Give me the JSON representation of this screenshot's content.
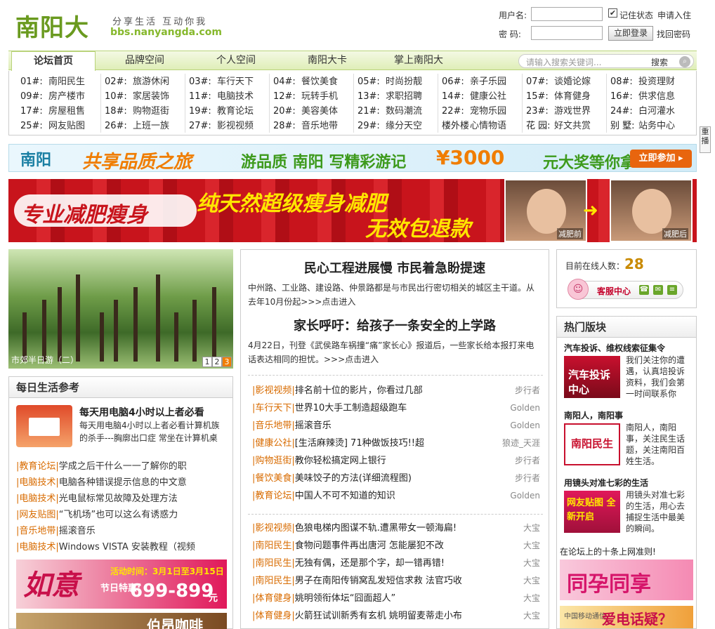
{
  "header": {
    "logo": "南阳大",
    "slogan": "分享生活 互动你我",
    "domain": "bbs.nanyangda.com"
  },
  "login": {
    "username_label": "用户名:",
    "password_label": "密  码:",
    "remember": "记住状态",
    "checked_mark": "✔",
    "apply": "申请入住",
    "login_button": "立即登录",
    "find_password": "找回密码"
  },
  "nav": {
    "tabs": [
      "论坛首页",
      "品牌空间",
      "个人空间",
      "南阳大卡",
      "掌上南阳大"
    ],
    "search_placeholder": "请输入搜索关键词...",
    "search_button": "搜索"
  },
  "boards": [
    {
      "num": "01#:",
      "name": "南阳民生"
    },
    {
      "num": "02#:",
      "name": "旅游休闲"
    },
    {
      "num": "03#:",
      "name": "车行天下"
    },
    {
      "num": "04#:",
      "name": "餐饮美食"
    },
    {
      "num": "05#:",
      "name": "时尚扮靓"
    },
    {
      "num": "06#:",
      "name": "亲子乐园"
    },
    {
      "num": "07#:",
      "name": "谈婚论嫁"
    },
    {
      "num": "08#:",
      "name": "投资理财"
    },
    {
      "num": "09#:",
      "name": "房产楼市"
    },
    {
      "num": "10#:",
      "name": "家居装饰"
    },
    {
      "num": "11#:",
      "name": "电脑技术"
    },
    {
      "num": "12#:",
      "name": "玩转手机"
    },
    {
      "num": "13#:",
      "name": "求职招聘"
    },
    {
      "num": "14#:",
      "name": "健康公社"
    },
    {
      "num": "15#:",
      "name": "体育健身"
    },
    {
      "num": "16#:",
      "name": "供求信息"
    },
    {
      "num": "17#:",
      "name": "房屋租售"
    },
    {
      "num": "18#:",
      "name": "购物逛街"
    },
    {
      "num": "19#:",
      "name": "教育论坛"
    },
    {
      "num": "20#:",
      "name": "美容美体"
    },
    {
      "num": "21#:",
      "name": "数码潮流"
    },
    {
      "num": "22#:",
      "name": "宠物乐园"
    },
    {
      "num": "23#:",
      "name": "游戏世界"
    },
    {
      "num": "24#:",
      "name": "白河灌水"
    },
    {
      "num": "25#:",
      "name": "网友贴图"
    },
    {
      "num": "26#:",
      "name": "上班一族"
    },
    {
      "num": "27#:",
      "name": "影视视频"
    },
    {
      "num": "28#:",
      "name": "音乐地带"
    },
    {
      "num": "29#:",
      "name": "缘分天空"
    },
    {
      "num": "楼外楼",
      "name": "心情物语"
    },
    {
      "num": "花 园:",
      "name": "好文共赏"
    },
    {
      "num": "别 墅:",
      "name": "站务中心"
    }
  ],
  "sidetag": "重播",
  "banner1": {
    "logo": "南阳",
    "t1": "共享品质之旅",
    "t2": "游品质 南阳 写精彩游记",
    "t3": "¥3000",
    "t4": "元大奖等你拿",
    "join": "立即参加 ▸"
  },
  "banner2": {
    "s1": "专业减肥瘦身",
    "s2": "纯天然超级瘦身减肥",
    "s3": "无效包退款",
    "arrow": "➜",
    "before": "减肥前",
    "after": "减肥后"
  },
  "photo": {
    "caption": "市郊半日游（二）",
    "pages": [
      "1",
      "2",
      "3"
    ]
  },
  "daily": {
    "title": "每日生活参考",
    "feature_title": "每天用电脑4小时以上者必看",
    "feature_desc": "每天用电脑4小时以上者必看计算机族的杀手---胸廓出口症 常坐在计算机桌",
    "items": [
      {
        "cat": "|教育论坛|",
        "text": "学成之后干什么一一了解你的职"
      },
      {
        "cat": "|电脑技术|",
        "text": "电脑各种错误提示信息的中文意"
      },
      {
        "cat": "|电脑技术|",
        "text": "光电鼠标常见故障及处理方法"
      },
      {
        "cat": "|网友贴图|",
        "text": "“飞机场”也可以这么有诱惑力"
      },
      {
        "cat": "|音乐地带|",
        "text": "摇滚音乐"
      },
      {
        "cat": "|电脑技术|",
        "text": "Windows VISTA 安装教程（视频"
      }
    ],
    "ad1": {
      "a": "如意",
      "b": "活动时间：3月1日至3月15日",
      "c": "节日特惠:",
      "d": "699-899",
      "e": "元"
    },
    "ad2": "伯昂咖啡"
  },
  "middle": {
    "news": [
      {
        "title": "民心工程进展慢 市民着急盼提速",
        "body": "中州路、工业路、建设路、仲景路都是与市民出行密切相关的城区主干道。从去年10月份起>>>点击进入"
      },
      {
        "title": "家长呼吁：给孩子一条安全的上学路",
        "body": "4月22日，刊登《武侯路车祸撞“痛”家长心》报道后，一些家长给本报打来电话表达相同的担忧。>>>点击进入"
      }
    ],
    "list1": [
      {
        "cat": "|影视视频|",
        "text": "排名前十位的影片，你看过几部",
        "author": "步行者"
      },
      {
        "cat": "|车行天下|",
        "text": "世界10大手工制造超级跑车",
        "author": "Golden"
      },
      {
        "cat": "|音乐地带|",
        "text": "摇滚音乐",
        "author": "Golden"
      },
      {
        "cat": "|健康公社|",
        "text": "[生活麻辣烫] 71种做饭技巧!!超",
        "author": "狼迹_天涯"
      },
      {
        "cat": "|购物逛街|",
        "text": "教你轻松搞定网上银行",
        "author": "步行者"
      },
      {
        "cat": "|餐饮美食|",
        "text": "美味饺子的方法(详细流程图)",
        "author": "步行者"
      },
      {
        "cat": "|教育论坛|",
        "text": "中国人不可不知道的知识",
        "author": "Golden"
      }
    ],
    "list2": [
      {
        "cat": "|影视视频|",
        "text": "色狼电梯内图谋不轨.遭黑带女一顿海扁!",
        "author": "大宝"
      },
      {
        "cat": "|南阳民生|",
        "text": "食物问题事件再出唐河 怎能屡犯不改",
        "author": "大宝"
      },
      {
        "cat": "|南阳民生|",
        "text": "无独有偶，还是那个字，却一错再错!",
        "author": "大宝"
      },
      {
        "cat": "|南阳民生|",
        "text": "男子在南阳传销窝乱发短信求救 法官巧收",
        "author": "大宝"
      },
      {
        "cat": "|体育健身|",
        "text": "姚明领衔体坛“囧面超人”",
        "author": "大宝"
      },
      {
        "cat": "|体育健身|",
        "text": "火箭狂试训新秀有玄机 姚明留麦蒂走小布",
        "author": "大宝"
      }
    ]
  },
  "online": {
    "label": "目前在线人数：",
    "count": "28",
    "service": "客服中心",
    "face": "☺",
    "icon_phone": "☎",
    "icon_mail": "✉",
    "icon_doc": "≡"
  },
  "hot": {
    "title": "热门版块",
    "sections": [
      {
        "title": "汽车投诉、维权线索征集令",
        "img_text": "汽车投诉中心",
        "desc": "我们关注你的遭遇，认真培投诉资料，我们会第一时间联系你"
      },
      {
        "title": "南阳人，南阳事",
        "img_text": "南阳民生",
        "desc": "南阳人，南阳事，关注民生话题，关注南阳百姓生活。"
      },
      {
        "title": "用镜头对准七彩的生活",
        "img_text": "网友贴图 全新开启",
        "desc": "用镜头对准七彩的生活，用心去捕捉生活中最美的瞬间。"
      }
    ],
    "rule": "在论坛上的十条上网准则!",
    "ad3": "同孕同享",
    "ad4_label": "中国移动通信",
    "ad4_text": "爱电话疑？"
  },
  "colors": {
    "brand_green": "#6a9a1f",
    "category_orange": "#d86b00",
    "accent_orange": "#f07d00"
  }
}
